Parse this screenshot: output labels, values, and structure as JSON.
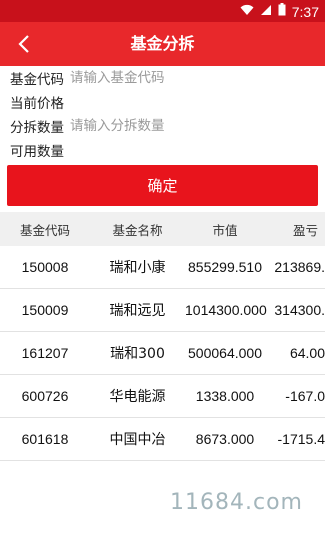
{
  "status_bar": {
    "time": "7:37",
    "icons": [
      "wifi-icon",
      "signal-icon",
      "battery-icon"
    ],
    "background": "#c8111b"
  },
  "header": {
    "title": "基金分拆",
    "back_icon": "chevron-left-icon",
    "background": "#e8282b"
  },
  "form": {
    "fund_code": {
      "label": "基金代码",
      "value": "",
      "placeholder": "请输入基金代码"
    },
    "current_price": {
      "label": "当前价格",
      "value": ""
    },
    "split_quantity": {
      "label": "分拆数量",
      "value": "",
      "placeholder": "请输入分拆数量"
    },
    "available_quantity": {
      "label": "可用数量",
      "value": ""
    },
    "confirm_label": "确定",
    "confirm_color": "#e8141c"
  },
  "table": {
    "headers": [
      "基金代码",
      "基金名称",
      "市值",
      "盈亏"
    ],
    "rows": [
      [
        "150008",
        "瑞和小康",
        "855299.510",
        "213869."
      ],
      [
        "150009",
        "瑞和远见",
        "1014300.000",
        "314300."
      ],
      [
        "161207",
        "瑞和300",
        "500064.000",
        "64.00"
      ],
      [
        "600726",
        "华电能源",
        "1338.000",
        "-167.0"
      ],
      [
        "601618",
        "中国中冶",
        "8673.000",
        "-1715.4"
      ]
    ]
  },
  "watermark": "11684.com"
}
